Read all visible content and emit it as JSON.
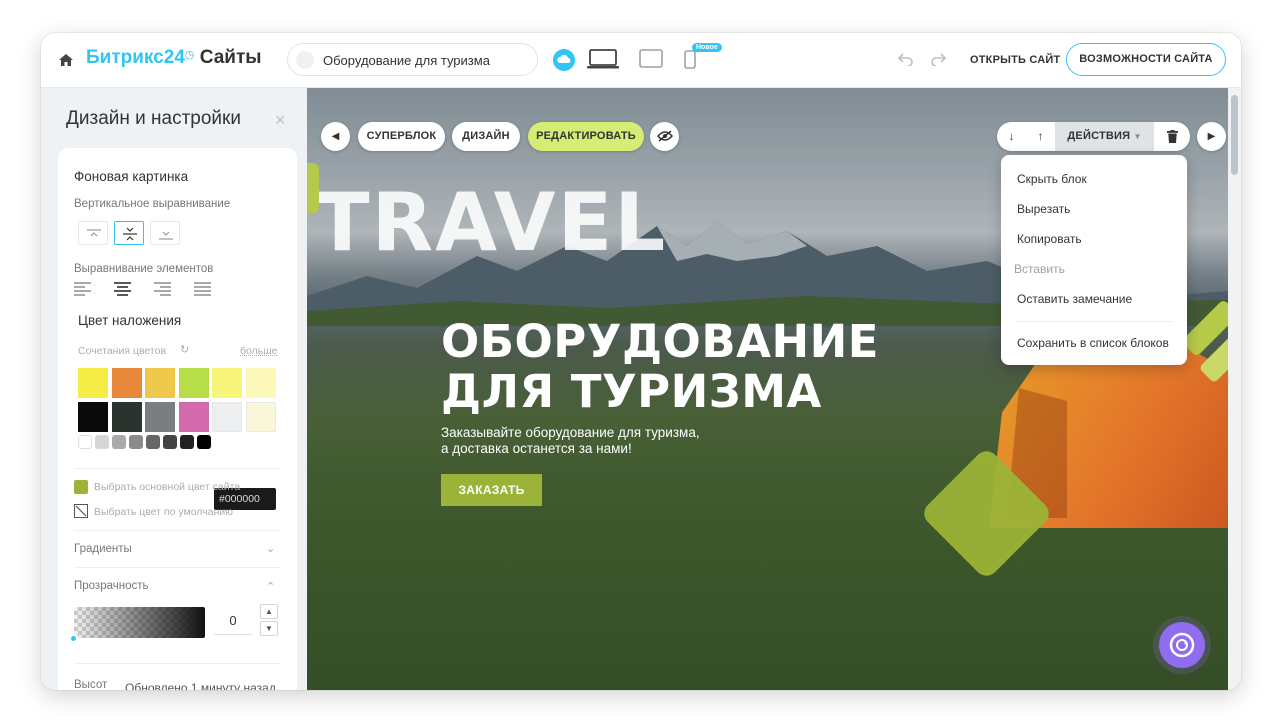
{
  "topbar": {
    "logo_brand": "Битрикс24",
    "logo_suffix": "Сайты",
    "page_name": "Оборудование для туризма",
    "new_badge": "Новое",
    "open_site": "ОТКРЫТЬ САЙТ",
    "features": "ВОЗМОЖНОСТИ САЙТА"
  },
  "panel": {
    "title": "Дизайн и настройки",
    "close": "×",
    "bg_image": "Фоновая картинка",
    "vertical_align": "Вертикальное выравнивание",
    "elements_align": "Выравнивание элементов",
    "overlay_color": "Цвет наложения",
    "color_combos": "Сочетания цветов",
    "more": "больше",
    "hex_value": "#000000",
    "pick_main_color": "Выбрать основной цвет сайта",
    "pick_default_color": "Выбрать цвет по умолчанию",
    "gradients": "Градиенты",
    "opacity": "Прозрачность",
    "opacity_value": "0",
    "height_label": "Высот",
    "updated": "Обновлено 1 минуту назад",
    "swatches": [
      "#f5ec45",
      "#e8883a",
      "#eec84a",
      "#b7dd49",
      "#f7f57a",
      "#fbf8b9",
      "#0a0a0a",
      "#2b332e",
      "#7a7e80",
      "#d36aad",
      "#eceeef",
      "#f9f6d9"
    ],
    "small_swatches": [
      "#ffffff",
      "#d6d6d6",
      "#aaaaaa",
      "#8a8a8a",
      "#666666",
      "#444444",
      "#222222",
      "#000000"
    ]
  },
  "toolbar": {
    "superblock": "СУПЕРБЛОК",
    "design": "ДИЗАЙН",
    "edit": "РЕДАКТИРОВАТЬ",
    "actions": "ДЕЙСТВИЯ"
  },
  "menu": {
    "hide_block": "Скрыть блок",
    "cut": "Вырезать",
    "copy": "Копировать",
    "paste": "Вставить",
    "leave_note": "Оставить замечание",
    "save_to_list": "Сохранить в список блоков"
  },
  "hero": {
    "travel": "TRAVEL",
    "title_line1": "ОБОРУДОВАНИЕ",
    "title_line2": "ДЛЯ ТУРИЗМА",
    "sub_line1": "Заказывайте оборудование для туризма,",
    "sub_line2": "а доставка останется за нами!",
    "order": "ЗАКАЗАТЬ"
  },
  "colors": {
    "accent": "#2fc6f6",
    "green": "#9bb337",
    "edit_green": "#d5ed75",
    "chat": "#8f6cf0"
  }
}
